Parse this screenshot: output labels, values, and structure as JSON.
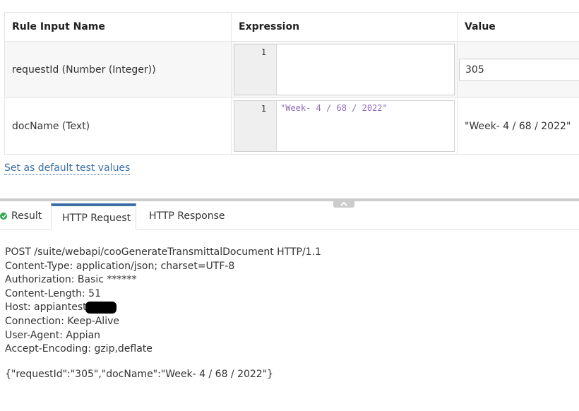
{
  "table": {
    "headers": [
      "Rule Input Name",
      "Expression",
      "Value"
    ],
    "rows": [
      {
        "name": "requestId (Number (Integer))",
        "line_no": "1",
        "expression": "",
        "value": "305"
      },
      {
        "name": "docName (Text)",
        "line_no": "1",
        "expression": "\"Week- 4 / 68 / 2022\"",
        "value": "\"Week- 4 / 68 / 2022\""
      }
    ]
  },
  "default_link": "Set as default test values",
  "tabs": [
    "Result",
    "HTTP Request",
    "HTTP Response"
  ],
  "active_tab": "HTTP Request",
  "http_request": {
    "lines": [
      "POST /suite/webapi/cooGenerateTransmittalDocument HTTP/1.1",
      "Content-Type: application/json; charset=UTF-8",
      "Authorization: Basic ******",
      "Content-Length: 51",
      "Host: appiantest",
      "Connection: Keep-Alive",
      "User-Agent: Appian",
      "Accept-Encoding: gzip,deflate"
    ],
    "body": "{\"requestId\":\"305\",\"docName\":\"Week- 4 / 68 / 2022\"}"
  },
  "colors": {
    "link": "#3a6ea5",
    "tab_accent": "#3c6ea8",
    "success": "#2ea44f",
    "code_string": "#8e6bb7"
  }
}
